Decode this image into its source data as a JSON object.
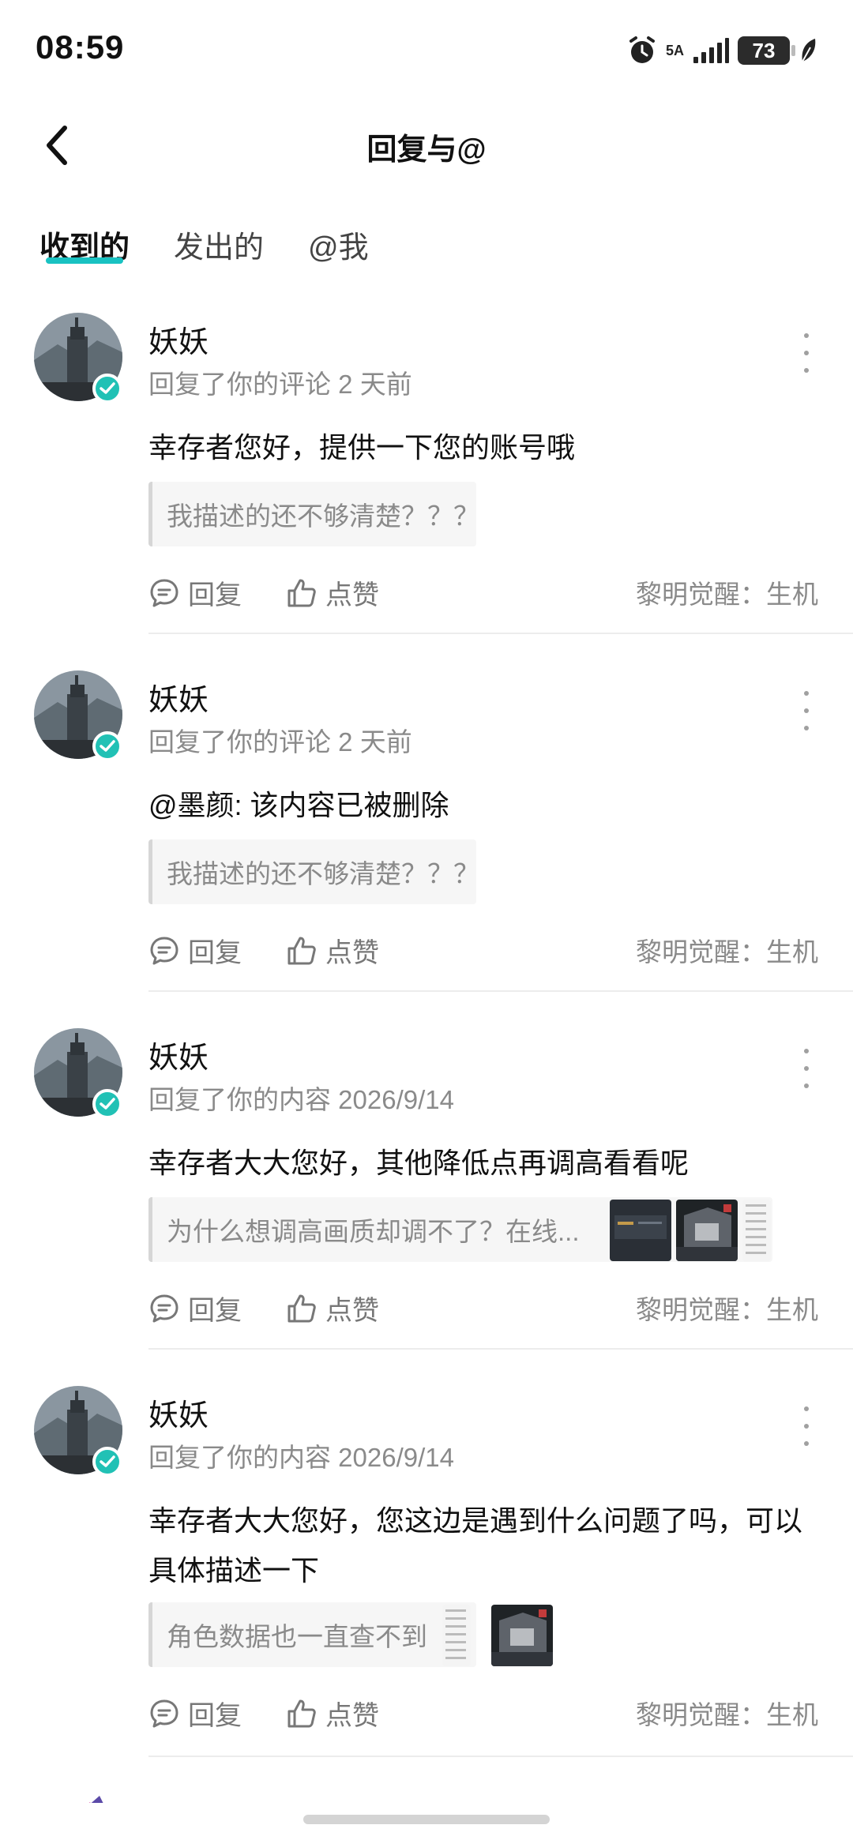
{
  "status_bar": {
    "time": "08:59",
    "network": "5A",
    "battery": "73"
  },
  "header": {
    "title": "回复与@"
  },
  "tabs": [
    {
      "label": "收到的",
      "active": true
    },
    {
      "label": "发出的",
      "active": false
    },
    {
      "label": "@我",
      "active": false
    }
  ],
  "notifications": [
    {
      "username": "妖妖",
      "meta": "回复了你的评论 2 天前",
      "reply": "幸存者您好，提供一下您的账号哦",
      "quote": "我描述的还不够清楚？？？",
      "reply_label": "回复",
      "like_label": "点赞",
      "source": "黎明觉醒：生机"
    },
    {
      "username": "妖妖",
      "meta": "回复了你的评论 2 天前",
      "reply": "@墨颜: 该内容已被删除",
      "quote": "我描述的还不够清楚？？？",
      "reply_label": "回复",
      "like_label": "点赞",
      "source": "黎明觉醒：生机"
    },
    {
      "username": "妖妖",
      "meta": "回复了你的内容 2026/9/14",
      "reply": "幸存者大大您好，其他降低点再调高看看呢",
      "quote": "为什么想调高画质却调不了？在线...",
      "reply_label": "回复",
      "like_label": "点赞",
      "source": "黎明觉醒：生机"
    },
    {
      "username": "妖妖",
      "meta": "回复了你的内容 2026/9/14",
      "reply": "幸存者大大您好，您这边是遇到什么问题了吗，可以具体描述一下",
      "quote": "角色数据也一直查不到",
      "reply_label": "回复",
      "like_label": "点赞",
      "source": "黎明觉醒：生机"
    }
  ],
  "colors": {
    "accent": "#19c2c2",
    "verified": "#21c1b5",
    "secondary_text": "#8a8a8a"
  }
}
